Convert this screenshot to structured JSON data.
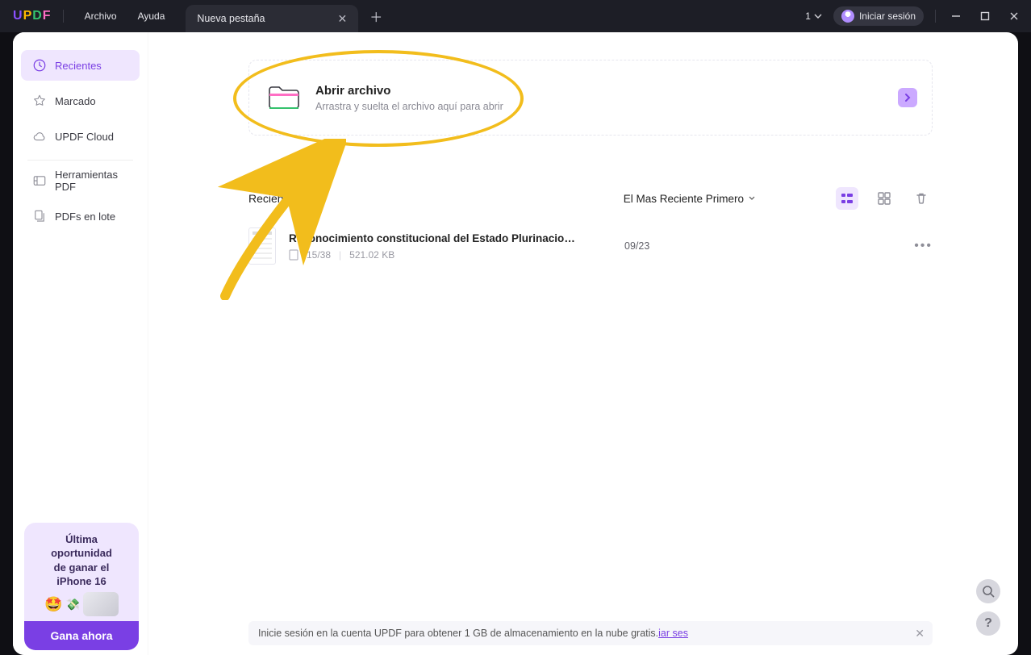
{
  "titlebar": {
    "logo_text": "UPDF",
    "menu": {
      "file": "Archivo",
      "help": "Ayuda"
    },
    "tab": {
      "label": "Nueva pestaña"
    },
    "counter": "1",
    "signin": "Iniciar sesión"
  },
  "sidebar": {
    "items": [
      {
        "label": "Recientes",
        "icon": "clock"
      },
      {
        "label": "Marcado",
        "icon": "star"
      },
      {
        "label": "UPDF Cloud",
        "icon": "cloud"
      },
      {
        "label": "Herramientas PDF",
        "icon": "tools"
      },
      {
        "label": "PDFs en lote",
        "icon": "batch"
      }
    ]
  },
  "openfile": {
    "title": "Abrir archivo",
    "subtitle": "Arrastra y suelta el archivo aquí para abrir"
  },
  "recent": {
    "section_title": "Recientes",
    "sort_label": "El Mas Reciente Primero",
    "files": [
      {
        "name": "Reconocimiento constitucional del Estado Plurinacional para la t…",
        "pages": "15/38",
        "size": "521.02 KB",
        "date": "09/23"
      }
    ]
  },
  "promo": {
    "line1": "Última",
    "line2": "oportunidad",
    "line3": "de ganar el",
    "line4": "iPhone 16",
    "button": "Gana ahora"
  },
  "banner": {
    "text": "Inicie sesión en la cuenta UPDF para obtener 1 GB de almacenamiento en la nube gratis.",
    "link": "iar ses"
  }
}
